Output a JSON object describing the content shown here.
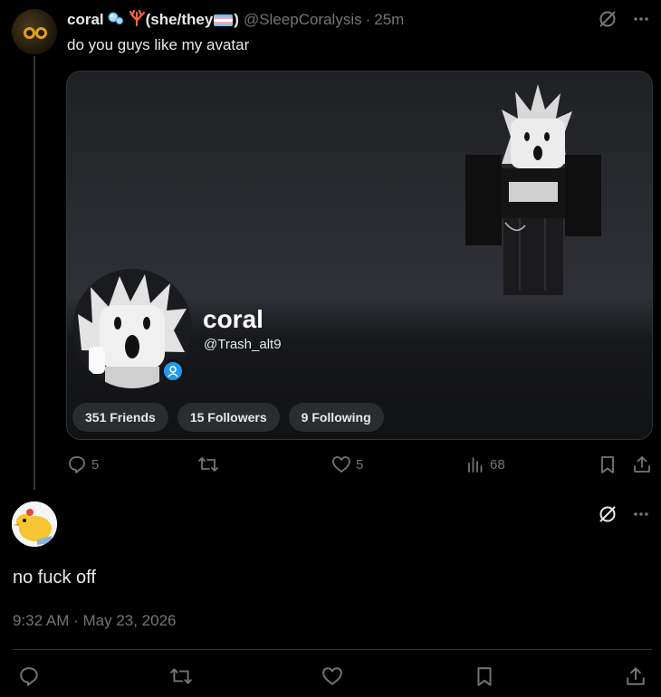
{
  "tweet1": {
    "author_name": "coral",
    "pronouns": "(she/they",
    "pronouns_close": ")",
    "handle": "@SleepCoralysis",
    "dot": "·",
    "time": "25m",
    "text": "do you guys like my avatar",
    "media": {
      "profile_name": "coral",
      "profile_handle": "@Trash_alt9",
      "friends": "351 Friends",
      "followers": "15 Followers",
      "following": "9 Following"
    },
    "actions": {
      "replies": "5",
      "reposts": "",
      "likes": "5",
      "views": "68"
    }
  },
  "tweet2": {
    "text": "no fuck off",
    "timestamp": "9:32 AM · May 23, 2026"
  },
  "colors": {
    "background": "#000000",
    "text": "#e7e9ea",
    "muted": "#71767b",
    "border": "#2f3336",
    "verified_blue": "#1d9bf0"
  },
  "icons": {
    "header": [
      "grok-icon",
      "more-icon"
    ],
    "tweet1_actions": [
      "reply-icon",
      "repost-icon",
      "like-icon",
      "views-icon",
      "bookmark-icon",
      "share-icon"
    ],
    "tweet2_actions": [
      "reply-icon",
      "repost-icon",
      "like-icon",
      "bookmark-icon",
      "share-icon"
    ]
  }
}
